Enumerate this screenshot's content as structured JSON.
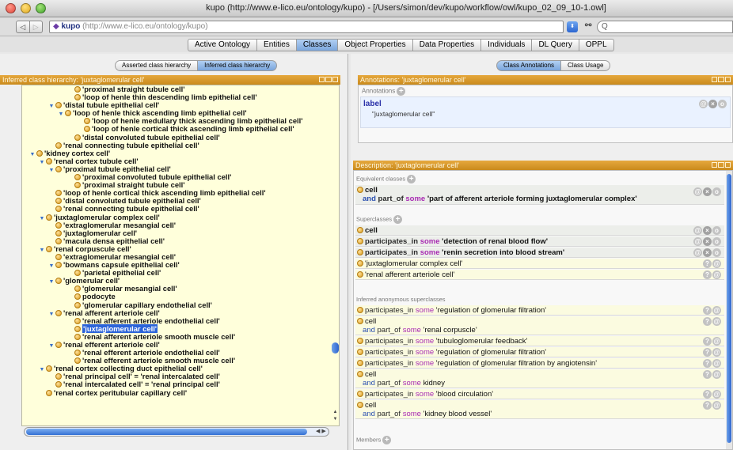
{
  "window": {
    "title": "kupo (http://www.e-lico.eu/ontology/kupo) - [/Users/simon/dev/kupo/workflow/owl/kupo_02_09_10-1.owl]"
  },
  "toolbar": {
    "back_label": "◁",
    "forward_label": "▷",
    "ontology_name": "kupo",
    "ontology_url": " (http://www.e-lico.eu/ontology/kupo)",
    "stepper_label": "⬍",
    "search_label": "Q"
  },
  "tabs": [
    "Active Ontology",
    "Entities",
    "Classes",
    "Object Properties",
    "Data Properties",
    "Individuals",
    "DL Query",
    "OPPL"
  ],
  "active_tab": "Classes",
  "left": {
    "subtabs": [
      "Asserted class hierarchy",
      "Inferred class hierarchy"
    ],
    "active_subtab": "Inferred class hierarchy",
    "header": "Inferred class hierarchy: 'juxtaglomerular cell'",
    "tree": [
      {
        "indent": 6,
        "twisty": "",
        "label": "'proximal straight tubule cell'"
      },
      {
        "indent": 6,
        "twisty": "",
        "label": "'loop of henle thin descending limb epithelial cell'"
      },
      {
        "indent": 4,
        "twisty": "▼",
        "label": "'distal tubule epithelial cell'"
      },
      {
        "indent": 5,
        "twisty": "▼",
        "label": "'loop of henle thick ascending limb epithelial cell'"
      },
      {
        "indent": 7,
        "twisty": "",
        "label": "'loop of henle medullary thick ascending limb epithelial cell'"
      },
      {
        "indent": 7,
        "twisty": "",
        "label": "'loop of henle cortical thick ascending limb epithelial cell'"
      },
      {
        "indent": 6,
        "twisty": "",
        "label": "'distal convoluted tubule epithelial cell'"
      },
      {
        "indent": 4,
        "twisty": "",
        "label": "'renal connecting tubule epithelial cell'"
      },
      {
        "indent": 2,
        "twisty": "▼",
        "label": "'kidney cortex cell'"
      },
      {
        "indent": 3,
        "twisty": "▼",
        "label": "'renal cortex tubule cell'"
      },
      {
        "indent": 4,
        "twisty": "▼",
        "label": "'proximal tubule epithelial cell'"
      },
      {
        "indent": 6,
        "twisty": "",
        "label": "'proximal convoluted tubule epithelial cell'"
      },
      {
        "indent": 6,
        "twisty": "",
        "label": "'proximal straight tubule cell'"
      },
      {
        "indent": 4,
        "twisty": "",
        "label": "'loop of henle cortical thick ascending limb epithelial cell'"
      },
      {
        "indent": 4,
        "twisty": "",
        "label": "'distal convoluted tubule epithelial cell'"
      },
      {
        "indent": 4,
        "twisty": "",
        "label": "'renal connecting tubule epithelial cell'"
      },
      {
        "indent": 3,
        "twisty": "▼",
        "label": "'juxtaglomerular complex cell'"
      },
      {
        "indent": 4,
        "twisty": "",
        "label": "'extraglomerular mesangial cell'"
      },
      {
        "indent": 4,
        "twisty": "",
        "label": "'juxtaglomerular cell'"
      },
      {
        "indent": 4,
        "twisty": "",
        "label": "'macula densa epithelial cell'"
      },
      {
        "indent": 3,
        "twisty": "▼",
        "label": "'renal corpuscule cell'"
      },
      {
        "indent": 4,
        "twisty": "",
        "label": "'extraglomerular mesangial cell'"
      },
      {
        "indent": 4,
        "twisty": "▼",
        "label": "'bowmans capsule epithelial cell'"
      },
      {
        "indent": 6,
        "twisty": "",
        "label": "'parietal epithelial cell'"
      },
      {
        "indent": 4,
        "twisty": "▼",
        "label": "'glomerular cell'"
      },
      {
        "indent": 6,
        "twisty": "",
        "label": "'glomerular mesangial cell'"
      },
      {
        "indent": 6,
        "twisty": "",
        "label": "podocyte"
      },
      {
        "indent": 6,
        "twisty": "",
        "label": "'glomerular capillary endothelial cell'"
      },
      {
        "indent": 4,
        "twisty": "▼",
        "label": "'renal afferent arteriole cell'"
      },
      {
        "indent": 6,
        "twisty": "",
        "label": "'renal afferent arteriole endothelial cell'"
      },
      {
        "indent": 6,
        "twisty": "",
        "label": "'juxtaglomerular cell'",
        "selected": true
      },
      {
        "indent": 6,
        "twisty": "",
        "label": "'renal afferent arteriole smooth muscle cell'"
      },
      {
        "indent": 4,
        "twisty": "▼",
        "label": "'renal efferent arteriole cell'"
      },
      {
        "indent": 6,
        "twisty": "",
        "label": "'renal efferent arteriole endothelial cell'"
      },
      {
        "indent": 6,
        "twisty": "",
        "label": "'renal efferent arteriole smooth muscle cell'"
      },
      {
        "indent": 3,
        "twisty": "▼",
        "label": "'renal cortex collecting duct epithelial cell'"
      },
      {
        "indent": 4,
        "twisty": "",
        "label": "'renal principal cell' = 'renal intercalated cell'"
      },
      {
        "indent": 4,
        "twisty": "",
        "label": "'renal intercalated cell' = 'renal principal cell'"
      },
      {
        "indent": 3,
        "twisty": "",
        "label": "'renal cortex peritubular capillary cell'"
      }
    ]
  },
  "right": {
    "subtabs": [
      "Class Annotations",
      "Class Usage"
    ],
    "active_subtab": "Class Annotations",
    "annot_header": "Annotations: 'juxtaglomerular cell'",
    "annot_section": "Annotations",
    "annot_key": "label",
    "annot_value": "\"juxtaglomerular cell\"",
    "desc_header": "Description: 'juxtaglomerular cell'",
    "sections": {
      "equivalent": "Equivalent classes",
      "superclasses": "Superclasses",
      "inferred": "Inferred anonymous superclasses",
      "members": "Members"
    },
    "equivalent": {
      "line1": "cell",
      "l2_and": "and ",
      "l2_prop": "part_of ",
      "l2_some": "some ",
      "l2_val": "'part of afferent arteriole forming juxtaglomerular complex'"
    },
    "superclasses": [
      {
        "prop": "",
        "some": "",
        "val": "cell"
      },
      {
        "prop": "participates_in ",
        "some": "some ",
        "val": "'detection of renal blood flow'"
      },
      {
        "prop": "participates_in ",
        "some": "some ",
        "val": "'renin secretion into blood stream'"
      },
      {
        "prop": "",
        "some": "",
        "val": "'juxtaglomerular complex cell'"
      },
      {
        "prop": "",
        "some": "",
        "val": "'renal afferent arteriole cell'"
      }
    ],
    "inferred": {
      "r1": {
        "prop": "participates_in ",
        "some": "some ",
        "val": "'regulation of glomerular filtration'"
      },
      "r2": {
        "l1": "cell",
        "and": "and ",
        "prop": "part_of ",
        "some": "some ",
        "val": "'renal corpuscle'"
      },
      "r3": {
        "prop": "participates_in ",
        "some": "some ",
        "val": "'tubuloglomerular feedback'"
      },
      "r4": {
        "prop": "participates_in ",
        "some": "some ",
        "val": "'regulation of glomerular filtration'"
      },
      "r5": {
        "prop": "participates_in ",
        "some": "some ",
        "val": "'regulation of glomerular filtration by angiotensin'"
      },
      "r6": {
        "l1": "cell",
        "and": "and ",
        "prop": "part_of ",
        "some": "some ",
        "val": "kidney"
      },
      "r7": {
        "prop": "participates_in ",
        "some": "some ",
        "val": "'blood circulation'"
      },
      "r8": {
        "l1": "cell",
        "and": "and ",
        "prop": "part_of ",
        "some": "some ",
        "val": "'kidney blood vessel'"
      }
    },
    "row_icons": {
      "help": "?",
      "annot": "@",
      "remove": "×",
      "edit": "o"
    }
  }
}
